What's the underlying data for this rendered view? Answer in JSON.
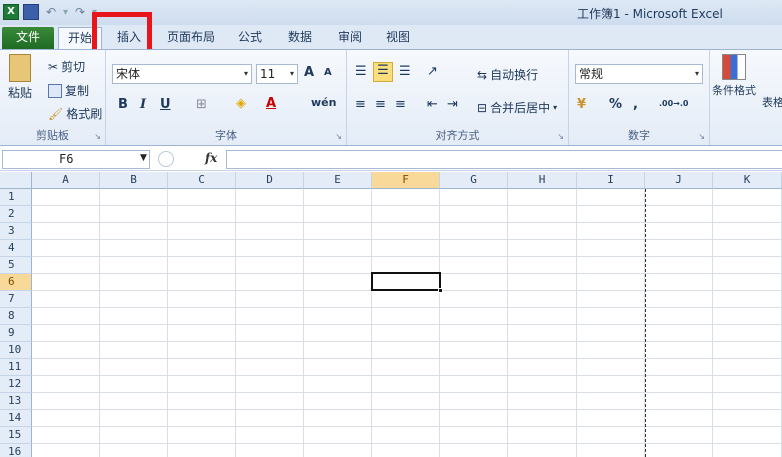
{
  "window": {
    "title": "工作簿1 - Microsoft Excel"
  },
  "tabs": [
    {
      "label": "文件"
    },
    {
      "label": "开始"
    },
    {
      "label": "插入"
    },
    {
      "label": "页面布局"
    },
    {
      "label": "公式"
    },
    {
      "label": "数据"
    },
    {
      "label": "审阅"
    },
    {
      "label": "视图"
    }
  ],
  "ribbon": {
    "clipboard": {
      "paste": "粘贴",
      "cut": "剪切",
      "copy": "复制",
      "format_painter": "格式刷",
      "group": "剪贴板"
    },
    "font": {
      "name": "宋体",
      "size": "11",
      "bold": "B",
      "italic": "I",
      "underline": "U",
      "grow": "A",
      "shrink": "A",
      "wen": "wén",
      "group": "字体"
    },
    "alignment": {
      "wrap": "自动换行",
      "merge": "合并后居中",
      "group": "对齐方式"
    },
    "number": {
      "format": "常规",
      "percent": "%",
      "comma": ",",
      "inc_dec": ".00→.0",
      "group": "数字"
    },
    "styles": {
      "conditional": "条件格式",
      "table": "表格"
    }
  },
  "formula_bar": {
    "name_box": "F6",
    "fx": "fx",
    "value": ""
  },
  "sheet": {
    "columns": [
      "A",
      "B",
      "C",
      "D",
      "E",
      "F",
      "G",
      "H",
      "I",
      "J",
      "K"
    ],
    "rows": [
      "1",
      "2",
      "3",
      "4",
      "5",
      "6",
      "7",
      "8",
      "9",
      "10",
      "11",
      "12",
      "13",
      "14",
      "15",
      "16"
    ],
    "active_cell": "F6"
  },
  "colors": {
    "accent": "#e8161b",
    "file_tab": "#2a7a2e",
    "header_active": "#f9d99a"
  }
}
